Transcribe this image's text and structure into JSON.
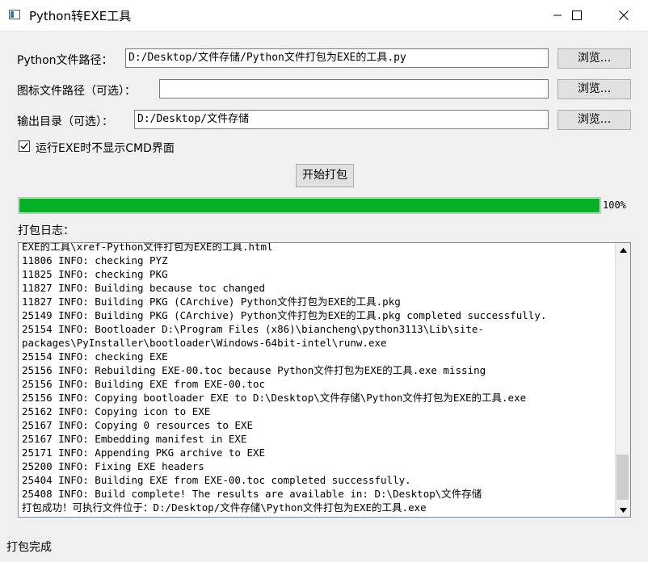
{
  "window": {
    "title": "Python转EXE工具"
  },
  "form": {
    "python_path_label": "Python文件路径：",
    "python_path_value": "D:/Desktop/文件存储/Python文件打包为EXE的工具.py",
    "icon_path_label": "图标文件路径（可选）：",
    "icon_path_value": "",
    "output_dir_label": "输出目录（可选）：",
    "output_dir_value": "D:/Desktop/文件存储",
    "browse_label": "浏览...",
    "no_console_label": "运行EXE时不显示CMD界面",
    "no_console_checked": true,
    "start_label": "开始打包"
  },
  "progress": {
    "value": 100,
    "text": "100%",
    "color": "#06b025"
  },
  "log": {
    "label": "打包日志：",
    "lines": [
      "EXE的工具\\xref-Python文件打包为EXE的工具.html",
      "11806 INFO: checking PYZ",
      "11825 INFO: checking PKG",
      "11827 INFO: Building because toc changed",
      "11827 INFO: Building PKG (CArchive) Python文件打包为EXE的工具.pkg",
      "25149 INFO: Building PKG (CArchive) Python文件打包为EXE的工具.pkg completed successfully.",
      "25154 INFO: Bootloader D:\\Program Files (x86)\\biancheng\\python3113\\Lib\\site-",
      "packages\\PyInstaller\\bootloader\\Windows-64bit-intel\\runw.exe",
      "25154 INFO: checking EXE",
      "25156 INFO: Rebuilding EXE-00.toc because Python文件打包为EXE的工具.exe missing",
      "25156 INFO: Building EXE from EXE-00.toc",
      "25156 INFO: Copying bootloader EXE to D:\\Desktop\\文件存储\\Python文件打包为EXE的工具.exe",
      "25162 INFO: Copying icon to EXE",
      "25167 INFO: Copying 0 resources to EXE",
      "25167 INFO: Embedding manifest in EXE",
      "25171 INFO: Appending PKG archive to EXE",
      "25200 INFO: Fixing EXE headers",
      "25404 INFO: Building EXE from EXE-00.toc completed successfully.",
      "25408 INFO: Build complete! The results are available in: D:\\Desktop\\文件存储",
      "打包成功！可执行文件位于：D:/Desktop/文件存储\\Python文件打包为EXE的工具.exe"
    ]
  },
  "status": {
    "text": "打包完成"
  }
}
